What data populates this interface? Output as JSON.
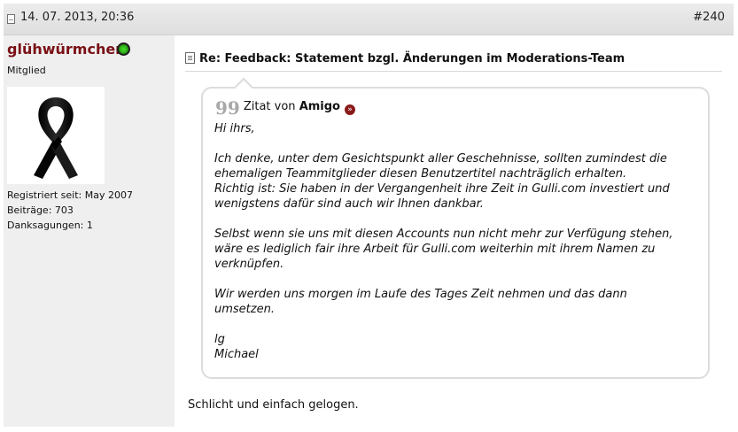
{
  "post": {
    "date": "14. 07. 2013, 20:36",
    "number": "#240"
  },
  "author": {
    "name": "glühwürmchen",
    "status_icon": "online-indicator-icon",
    "rank": "Mitglied",
    "avatar": "black-ribbon",
    "registered": "Registriert seit: May 2007",
    "posts": "Beiträge: 703",
    "thanks": "Danksagungen: 1"
  },
  "message": {
    "title": "Re: Feedback: Statement bzgl. Änderungen im Moderations-Team",
    "quote": {
      "label": "Zitat von",
      "author": "Amigo",
      "greeting": "Hi ihrs,",
      "para1": [
        "Ich denke, unter dem Gesichtspunkt aller Geschehnisse, sollten zumindest die",
        "ehemaligen Teammitglieder diesen Benutzertitel nachträglich erhalten.",
        "Richtig ist: Sie haben in der Vergangenheit ihre Zeit in Gulli.com investiert und",
        "wenigstens dafür sind auch wir Ihnen dankbar."
      ],
      "para2": [
        "Selbst wenn sie uns mit diesen Accounts nun nicht mehr zur Verfügung stehen,",
        "wäre es lediglich fair ihre Arbeit für Gulli.com weiterhin mit ihrem Namen zu",
        "verknüpfen."
      ],
      "para3": [
        "Wir werden uns morgen im Laufe des Tages Zeit nehmen und das dann",
        "umsetzen."
      ],
      "signoff": [
        "lg",
        "Michael"
      ]
    },
    "reply": "Schlicht und einfach gelogen."
  },
  "colors": {
    "username": "#7a1015",
    "header_bg": "#e4e4e4",
    "sidebar_bg": "#efefef",
    "quote_border": "#dcdcdc"
  }
}
